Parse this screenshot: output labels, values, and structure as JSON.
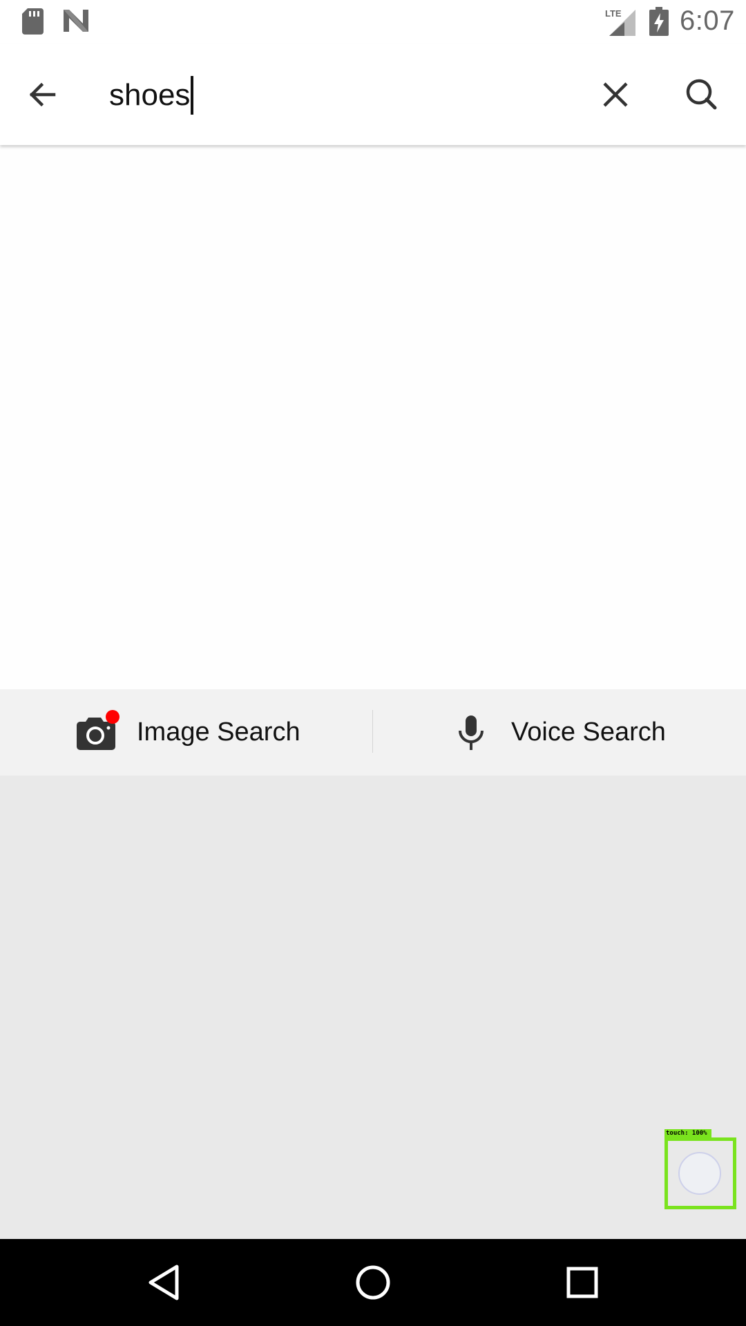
{
  "status_bar": {
    "time": "6:07",
    "network_label": "LTE",
    "icons": [
      "sd-card-icon",
      "n-notification-icon",
      "lte-signal-icon",
      "battery-charging-icon"
    ]
  },
  "search_bar": {
    "query": "shoes",
    "icons": [
      "back-arrow-icon",
      "clear-icon",
      "search-icon"
    ]
  },
  "search_options": {
    "image_search_label": "Image Search",
    "voice_search_label": "Voice Search",
    "image_search_badge_color": "#ff0000"
  },
  "touch_indicator": {
    "label": "touch: 100%",
    "color": "#7ae31e"
  },
  "nav_bar": {
    "icons": [
      "nav-back-icon",
      "nav-home-icon",
      "nav-recents-icon"
    ]
  }
}
